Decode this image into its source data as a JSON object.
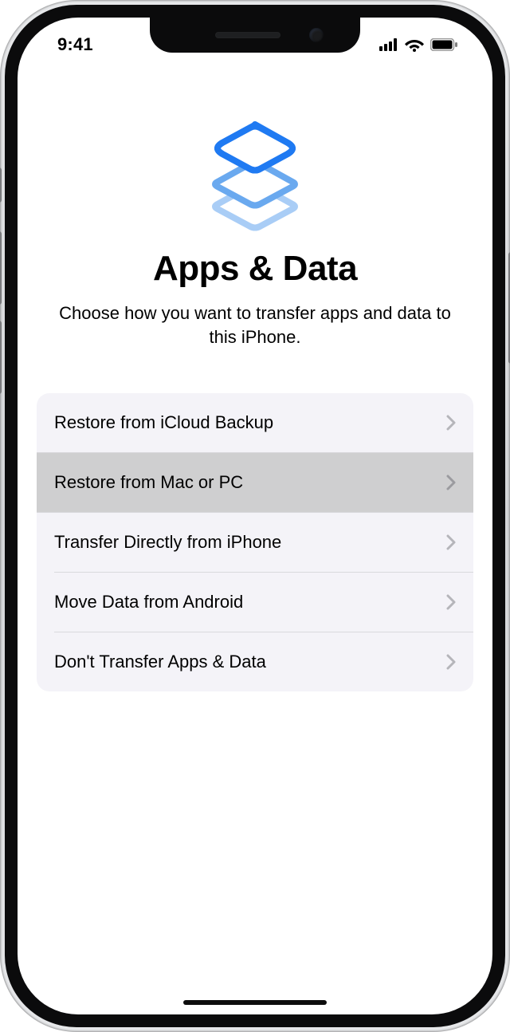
{
  "status": {
    "time": "9:41"
  },
  "header": {
    "title": "Apps & Data",
    "subtitle": "Choose how you want to transfer apps and data to this iPhone."
  },
  "options": [
    {
      "label": "Restore from iCloud Backup",
      "highlight": false
    },
    {
      "label": "Restore from Mac or PC",
      "highlight": true
    },
    {
      "label": "Transfer Directly from iPhone",
      "highlight": false
    },
    {
      "label": "Move Data from Android",
      "highlight": false
    },
    {
      "label": "Don't Transfer Apps & Data",
      "highlight": false
    }
  ]
}
